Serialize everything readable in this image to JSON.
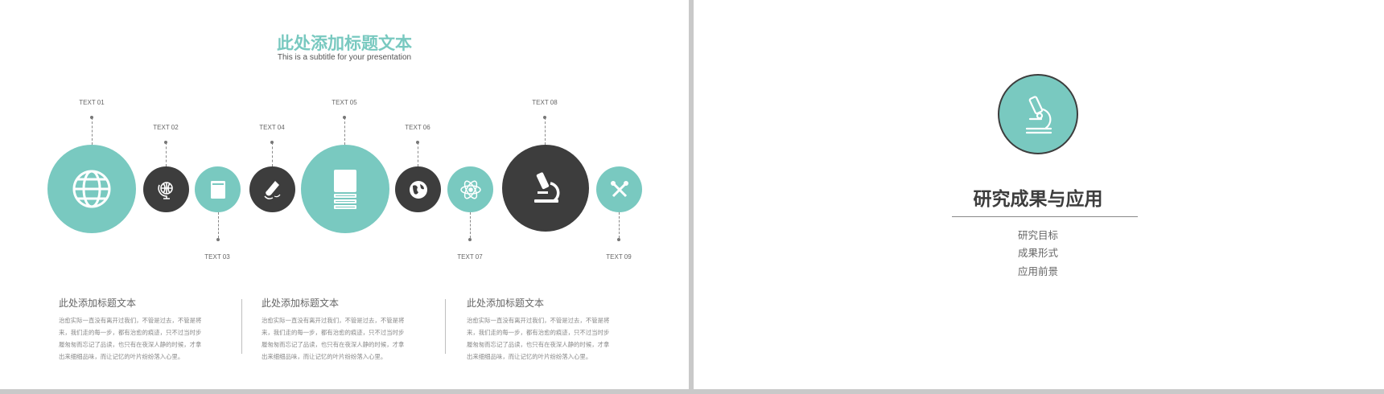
{
  "left": {
    "title": "此处添加标题文本",
    "subtitle": "This is a subtitle for your presentation",
    "timeline": [
      {
        "label": "TEXT 01",
        "icon": "globe-icon",
        "color": "#79c9c0"
      },
      {
        "label": "TEXT 02",
        "icon": "desk-globe-icon",
        "color": "#3d3d3d"
      },
      {
        "label": "TEXT 03",
        "icon": "book-icon",
        "color": "#79c9c0"
      },
      {
        "label": "TEXT 04",
        "icon": "test-tube-icon",
        "color": "#3d3d3d"
      },
      {
        "label": "TEXT 05",
        "icon": "books-stack-icon",
        "color": "#79c9c0"
      },
      {
        "label": "TEXT 06",
        "icon": "earth-icon",
        "color": "#3d3d3d"
      },
      {
        "label": "TEXT 07",
        "icon": "atom-icon",
        "color": "#79c9c0"
      },
      {
        "label": "TEXT 08",
        "icon": "microscope-icon",
        "color": "#3d3d3d"
      },
      {
        "label": "TEXT 09",
        "icon": "dna-icon",
        "color": "#79c9c0"
      }
    ],
    "columns": [
      {
        "title": "此处添加标题文本",
        "lines": [
          "治愈实际一直没有离开过我们，不管是过去，不管是将",
          "来，我们走的每一步，都有治愈的痕迹，只不过当时步",
          "履匆匆而忘记了品读，也只有在夜深人静的时候，才拿",
          "出来细细品味，而让记忆的叶片纷纷落入心里。"
        ]
      },
      {
        "title": "此处添加标题文本",
        "lines": [
          "治愈实际一直没有离开过我们，不管是过去，不管是将",
          "来，我们走的每一步，都有治愈的痕迹，只不过当时步",
          "履匆匆而忘记了品读，也只有在夜深人静的时候，才拿",
          "出来细细品味，而让记忆的叶片纷纷落入心里。"
        ]
      },
      {
        "title": "此处添加标题文本",
        "lines": [
          "治愈实际一直没有离开过我们，不管是过去，不管是将",
          "来，我们走的每一步，都有治愈的痕迹，只不过当时步",
          "履匆匆而忘记了品读，也只有在夜深人静的时候，才拿",
          "出来细细品味，而让记忆的叶片纷纷落入心里。"
        ]
      }
    ]
  },
  "right": {
    "icon": "microscope-icon",
    "title": "研究成果与应用",
    "items": [
      "研究目标",
      "成果形式",
      "应用前景"
    ]
  },
  "colors": {
    "accent": "#79c9c0",
    "dark": "#3d3d3d"
  }
}
